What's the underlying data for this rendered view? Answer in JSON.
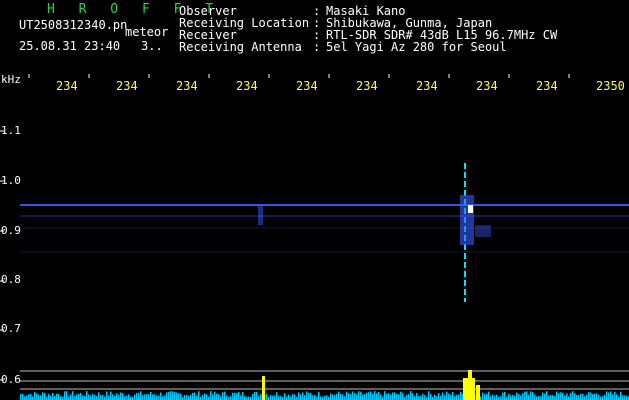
{
  "header": {
    "title": "H R O F F T",
    "file_name": "UT2508312340.pn",
    "meteor_label": "meteor",
    "date_time": "25.08.31 23:40",
    "extra": "3..",
    "info": [
      {
        "label": "Observer",
        "value": "Masaki Kano"
      },
      {
        "label": "Receiving Location",
        "value": "Shibukawa, Gunma, Japan"
      },
      {
        "label": "Receiver",
        "value": "RTL-SDR SDR# 43dB L15 96.7MHz CW"
      },
      {
        "label": "Receiving Antenna",
        "value": "5el Yagi Az 280 for Seoul"
      }
    ]
  },
  "axis": {
    "y_unit": "kHz",
    "y_ticks": [
      "1.1",
      "1.0",
      "0.9",
      "0.8",
      "0.7",
      "0.6"
    ],
    "x_ticks": [
      "234",
      "234",
      "234",
      "234",
      "234",
      "234",
      "234",
      "234",
      "234",
      "2350"
    ]
  },
  "colors": {
    "title": "#2fd34a",
    "tick_labels": "#ffff3a",
    "text": "#ffffff",
    "signal": "#3a5cff",
    "meteor": "#00e5ff",
    "power_bars": "#ffff00",
    "noise_floor": "#00c8ff"
  }
}
